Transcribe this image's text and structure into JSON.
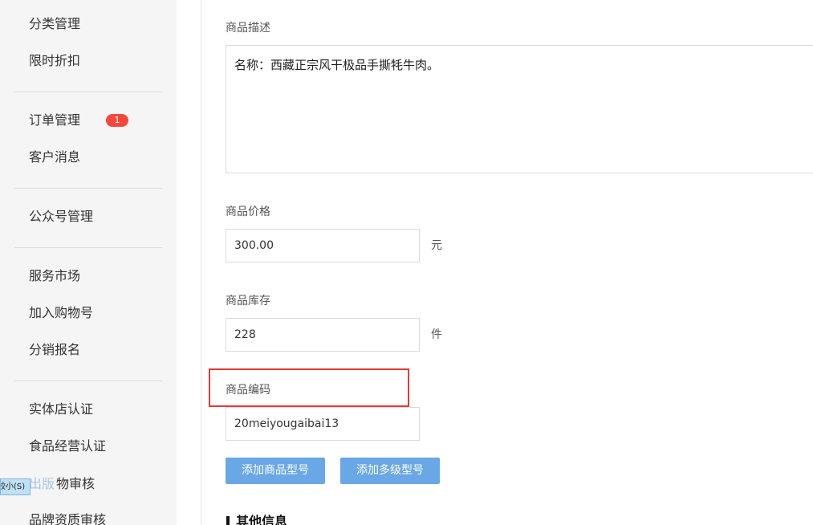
{
  "sidebar": {
    "items": [
      {
        "label": "分类管理"
      },
      {
        "label": "限时折扣"
      },
      {
        "label": "订单管理",
        "badge": "1"
      },
      {
        "label": "客户消息"
      },
      {
        "label": "公众号管理"
      },
      {
        "label": "服务市场"
      },
      {
        "label": "加入购物号"
      },
      {
        "label": "分销报名"
      },
      {
        "label": "实体店认证"
      },
      {
        "label": "食品经营认证"
      },
      {
        "label": "物审核"
      },
      {
        "label": "品牌资质审核"
      }
    ],
    "ime": {
      "candidate": "较小(S)",
      "overlay_text": "出版"
    }
  },
  "form": {
    "description": {
      "label": "商品描述",
      "value": "名称：西藏正宗风干极品手撕牦牛肉。"
    },
    "price": {
      "label": "商品价格",
      "value": "300.00",
      "unit": "元"
    },
    "stock": {
      "label": "商品库存",
      "value": "228",
      "unit": "件"
    },
    "code": {
      "label": "商品编码",
      "value": "20meiyougaibai13"
    },
    "buttons": {
      "add_model": "添加商品型号",
      "add_multi_model": "添加多级型号"
    },
    "other_section_title": "其他信息"
  },
  "colors": {
    "accent_button": "#6aa7e6",
    "badge": "#f5483b",
    "highlight_box": "#e53935",
    "sidebar_bg": "#f5f5f5"
  }
}
